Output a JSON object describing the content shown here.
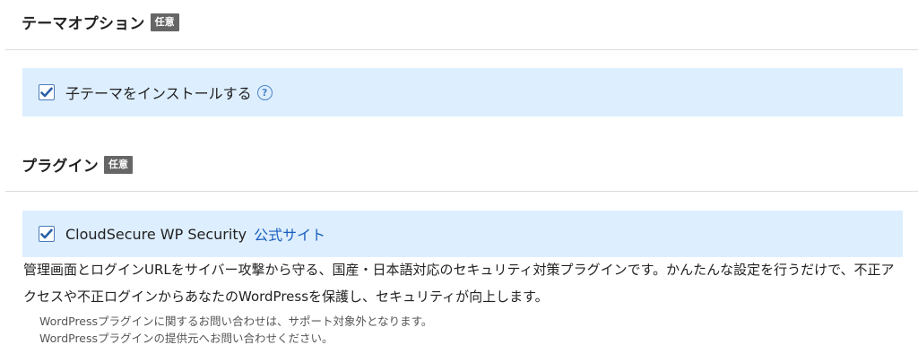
{
  "theme_section": {
    "title": "テーマオプション",
    "badge": "任意",
    "option": {
      "label": "子テーマをインストールする",
      "checked": true,
      "help_icon": "question-circle-icon"
    }
  },
  "plugin_section": {
    "title": "プラグイン",
    "badge": "任意",
    "option": {
      "label": "CloudSecure WP Security",
      "checked": true,
      "link_text": "公式サイト"
    },
    "description": "管理画面とログインURLをサイバー攻撃から守る、国産・日本語対応のセキュリティ対策プラグインです。かんたんな設定を行うだけで、不正アクセスや不正ログインからあなたのWordPressを保護し、セキュリティが向上します。",
    "notes": [
      "WordPressプラグインに関するお問い合わせは、サポート対象外となります。",
      "WordPressプラグインの提供元へお問い合わせください。"
    ]
  },
  "colors": {
    "option_background": "#ddeefe",
    "badge_background": "#666666",
    "link": "#1a5fc0",
    "checkbox_border": "#4c7ab8",
    "checkmark": "#2a5fa8"
  }
}
